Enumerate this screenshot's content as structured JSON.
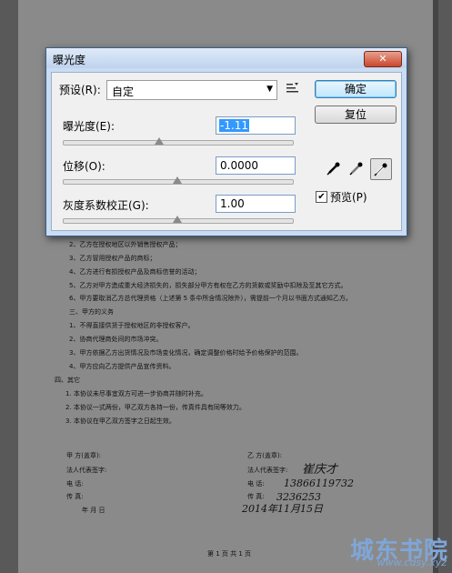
{
  "dialog": {
    "title": "曝光度",
    "close_glyph": "✕",
    "preset_label": "预设(R):",
    "preset_value": "自定",
    "exposure": {
      "label": "曝光度(E):",
      "value": "-1.11",
      "level": 0.42
    },
    "offset": {
      "label": "位移(O):",
      "value": "0.0000",
      "level": 0.5
    },
    "gamma": {
      "label": "灰度系数校正(G):",
      "value": "1.00",
      "level": 0.5
    },
    "ok_label": "确定",
    "reset_label": "复位",
    "preview_label": "预览(P)",
    "preview_checked": true,
    "icons": [
      "preset-options-icon",
      "black-eyedropper-icon",
      "gray-eyedropper-icon",
      "white-eyedropper-icon"
    ]
  },
  "document": {
    "clauses": [
      "2、乙方在授权地区以外销售授权产品；",
      "3、乙方冒用授权产品的商标；",
      "4、乙方进行有损授权产品及商标信誉的活动；",
      "5、乙方对甲方造成重大经济损失的，损失部分甲方有权在乙方的货款或奖励中扣除及至其它方式。",
      "6、甲方要取消乙方总代理资格（上述第 5 条中所含情况除外），需提前一个月以书面方式通知乙方。",
      "三、甲方的义务",
      "1、不得直接供货于授权地区的非授权客户。",
      "2、协商代理商处间的市场冲突。",
      "3、甲方依据乙方出货情况及市场变化情况，确定调整价格时给予价格保护的范围。",
      "4、甲方应向乙方提供产品宣传资料。",
      "四、其它",
      "1. 本协议未尽事宜双方可进一步协商并随时补充。",
      "2. 本协议一式两份，甲乙双方各持一份，传真件具有同等效力。",
      "3. 本协议在甲乙双方签字之日起生效。"
    ],
    "party_a": {
      "party": "甲   方(盖章):",
      "rep": "法人代表签字:",
      "phone": "电   话:",
      "fax": "传   真:",
      "date": "年    月    日"
    },
    "party_b": {
      "party": "乙   方(盖章):",
      "rep": "法人代表签字:",
      "phone": "电   话:",
      "fax": "传   真:"
    },
    "handwriting": {
      "signature": "崔庆才",
      "phone": "13866119732",
      "fax": "3236253",
      "date": "2014年11月15日"
    },
    "page_footer": "第 1 页 共 1 页"
  },
  "watermark": {
    "text": "城东书院",
    "url": "www.cdsy.xyz"
  }
}
